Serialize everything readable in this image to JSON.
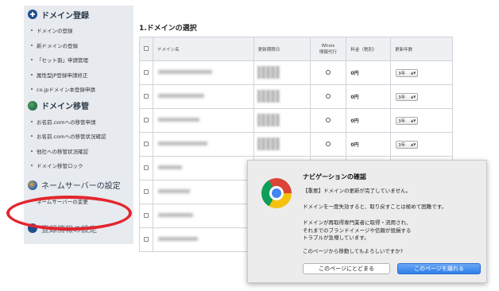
{
  "sidebar": {
    "sections": [
      {
        "title": "ドメイン登録",
        "icon": "plus-icon",
        "items": [
          "ドメインの登録",
          "新ドメインの登録",
          "「セット割」申請管理",
          "属性型JP登録申請修正",
          "co.jpドメイン本登録申請"
        ]
      },
      {
        "title": "ドメイン移管",
        "icon": "globe-icon",
        "items": [
          "お名前.comへの移管申請",
          "お名前.comへの移管状況確認",
          "他社への移管状況確認",
          "ドメイン移管ロック"
        ]
      },
      {
        "title": "ネームサーバーの設定",
        "icon": "server-globe-icon",
        "items": [
          "ネームサーバーの変更"
        ]
      },
      {
        "title": "登録情報の設定",
        "icon": "settings-icon",
        "items": []
      }
    ]
  },
  "main": {
    "title": "1.ドメインの選択",
    "table": {
      "headers": [
        "",
        "ドメイン名",
        "更新期限日",
        "Whois\n情報代行",
        "料金（税別）",
        "更新年数"
      ],
      "rows": [
        {
          "whois": "○",
          "fee": "0円",
          "years": "3年"
        },
        {
          "whois": "○",
          "fee": "0円",
          "years": "3年"
        },
        {
          "whois": "○",
          "fee": "0円",
          "years": "3年"
        },
        {
          "whois": "○",
          "fee": "0円",
          "years": "3年"
        },
        {
          "whois": "",
          "fee": "",
          "years": ""
        },
        {
          "whois": "",
          "fee": "",
          "years": ""
        },
        {
          "whois": "",
          "fee": "",
          "years": ""
        },
        {
          "whois": "",
          "fee": "",
          "years": ""
        }
      ]
    }
  },
  "dialog": {
    "title": "ナビゲーションの確認",
    "line1": "【重要】ドメインの更新が完了していません。",
    "line2": "ドメインを一度失効すると、取り戻すことは極めて困難です。",
    "line3a": "ドメインが再取得専門業者に取得・流用され、",
    "line3b": "それまでのブランドイメージや信頼が毀損する",
    "line3c": "トラブルが急増しています。",
    "line4": "このページから移動してもよろしいですか?",
    "stay_label": "このページにとどまる",
    "leave_label": "このページを離れる"
  }
}
